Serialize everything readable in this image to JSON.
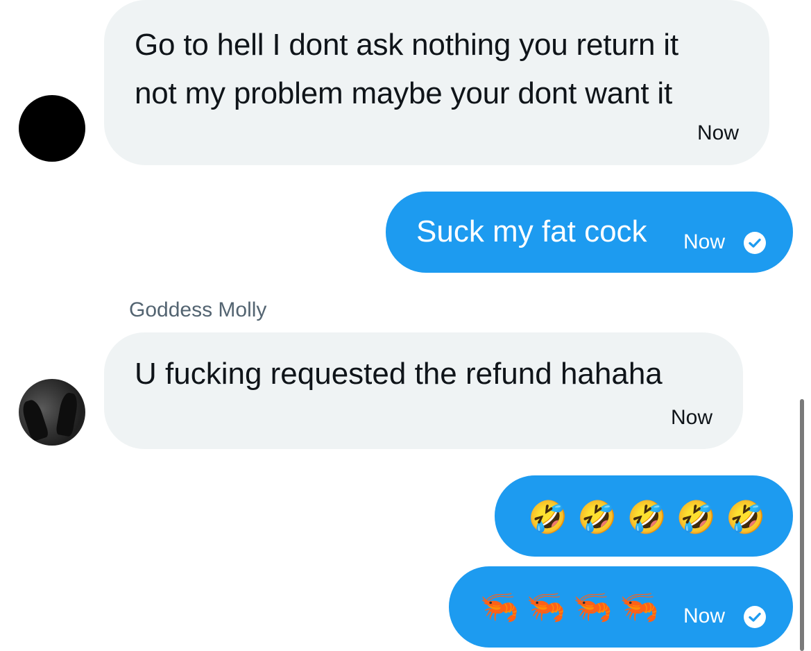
{
  "messages": [
    {
      "direction": "incoming",
      "text_line1": "Go to hell I dont ask nothing you return it",
      "text_line2": "not my problem maybe your dont want it",
      "time": "Now"
    },
    {
      "direction": "outgoing",
      "text": "Suck my fat cock",
      "time": "Now",
      "status_icon": "check-circle-icon"
    },
    {
      "direction": "incoming",
      "sender": "Goddess Molly",
      "text": "U fucking requested the refund hahaha",
      "time": "Now"
    },
    {
      "direction": "outgoing",
      "emojis": "🤣🤣🤣🤣🤣"
    },
    {
      "direction": "outgoing",
      "emojis": "🦐🦐🦐🦐",
      "time": "Now",
      "status_icon": "check-circle-icon"
    }
  ],
  "colors": {
    "incoming_bubble": "#eff3f4",
    "outgoing_bubble": "#1d9bf0",
    "sender_name": "#536471",
    "text_dark": "#0f1419"
  }
}
